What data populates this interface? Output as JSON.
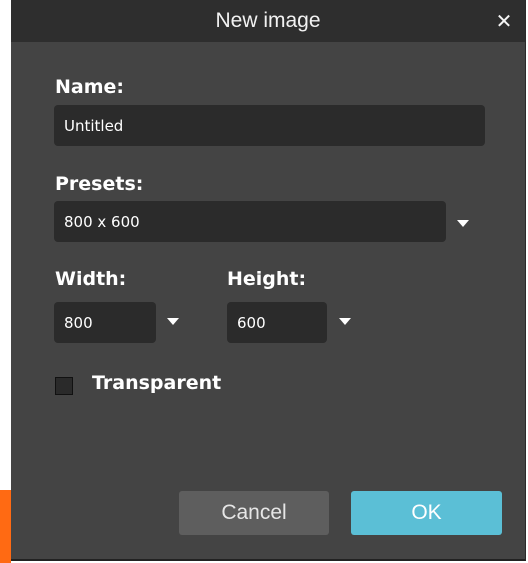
{
  "dialog": {
    "title": "New image",
    "close_icon": "close-icon"
  },
  "name": {
    "label": "Name:",
    "value": "Untitled"
  },
  "presets": {
    "label": "Presets:",
    "selected": "800 x 600"
  },
  "width": {
    "label": "Width:",
    "selected": "800"
  },
  "height": {
    "label": "Height:",
    "selected": "600"
  },
  "transparent": {
    "label": "Transparent",
    "checked": false
  },
  "buttons": {
    "cancel_label": "Cancel",
    "ok_label": "OK"
  },
  "colors": {
    "dialog_bg": "#444444",
    "titlebar_bg": "#2e2e2e",
    "field_bg": "#2b2b2b",
    "ok_bg": "#5bbfd6",
    "cancel_bg": "#5e5e5e",
    "accent_orange": "#ff6a13"
  }
}
